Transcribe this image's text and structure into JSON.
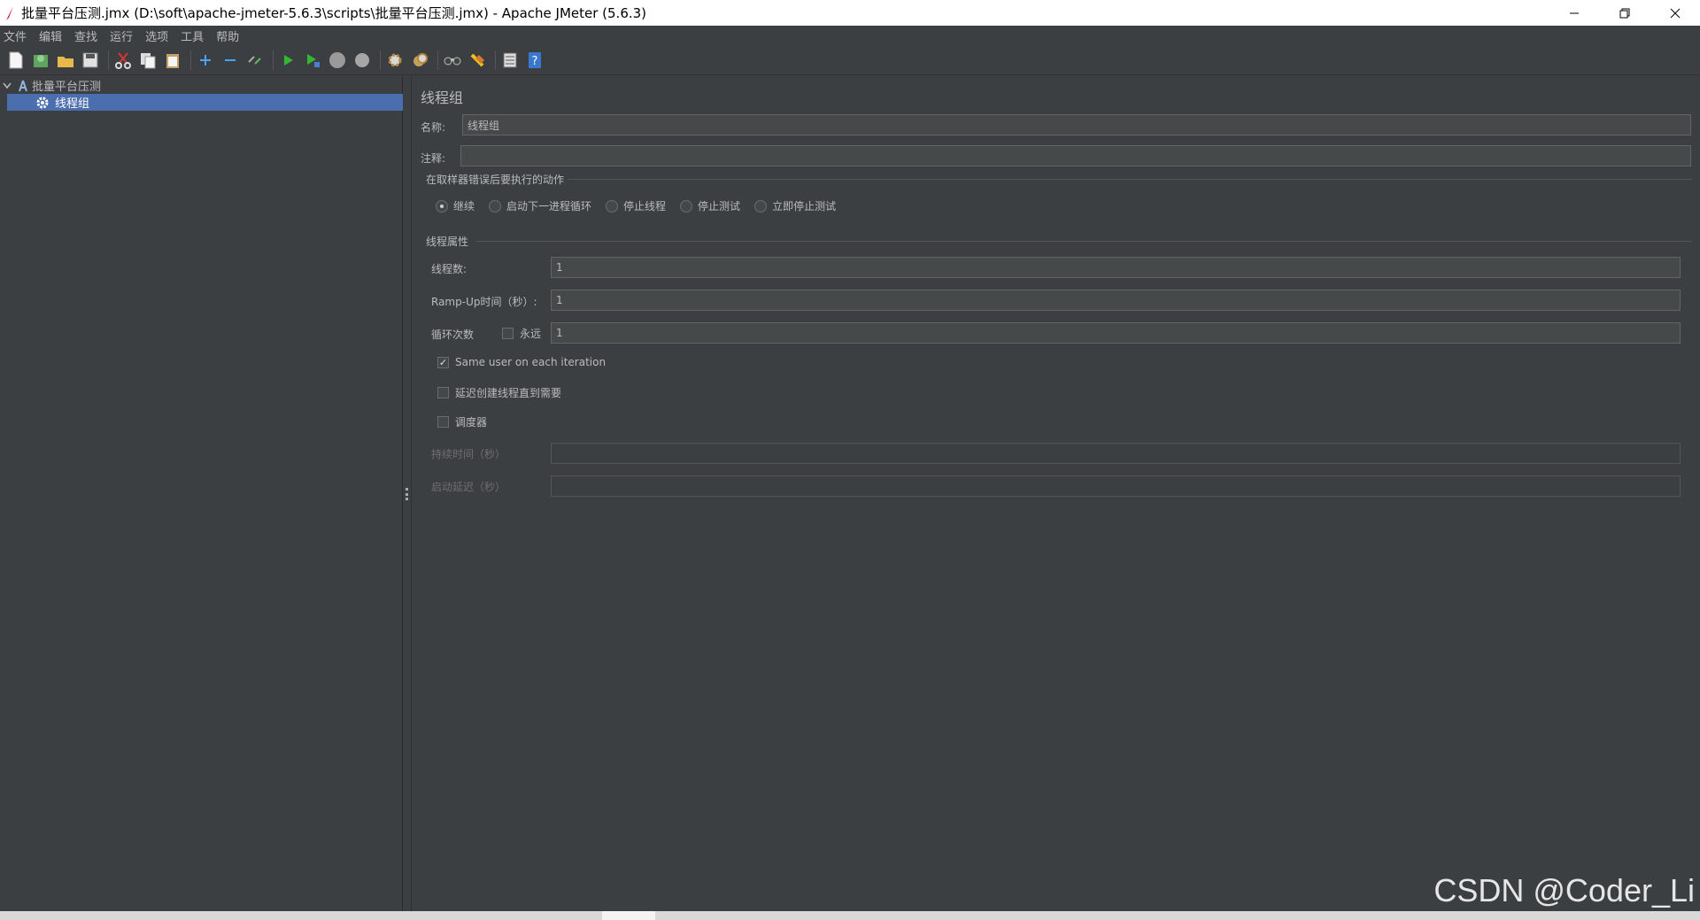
{
  "window": {
    "title": "批量平台压测.jmx (D:\\soft\\apache-jmeter-5.6.3\\scripts\\批量平台压测.jmx) - Apache JMeter (5.6.3)"
  },
  "menu": [
    "文件",
    "编辑",
    "查找",
    "运行",
    "选项",
    "工具",
    "帮助"
  ],
  "toolbar": {
    "icons": [
      "new-icon",
      "templates-icon",
      "open-icon",
      "save-icon",
      "cut-icon",
      "copy-icon",
      "paste-icon",
      "expand-icon",
      "collapse-icon",
      "toggle-icon",
      "start-icon",
      "start-no-pause-icon",
      "stop-icon",
      "shutdown-icon",
      "clear-icon",
      "clear-all-icon",
      "search-icon",
      "reset-search-icon",
      "function-helper-icon",
      "help-icon"
    ]
  },
  "tree": {
    "root": "批量平台压测",
    "child": "线程组"
  },
  "panel": {
    "title": "线程组",
    "name_label": "名称:",
    "name_value": "线程组",
    "comment_label": "注释:",
    "comment_value": "",
    "error_section": "在取样器错误后要执行的动作",
    "error_options": [
      "继续",
      "启动下一进程循环",
      "停止线程",
      "停止测试",
      "立即停止测试"
    ],
    "thread_section": "线程属性",
    "threads_label": "线程数:",
    "threads_value": "1",
    "rampup_label": "Ramp-Up时间（秒）:",
    "rampup_value": "1",
    "loop_label": "循环次数",
    "forever_label": "永远",
    "loop_value": "1",
    "same_user_label": "Same user on each iteration",
    "delay_label": "延迟创建线程直到需要",
    "scheduler_label": "调度器",
    "duration_label": "持续时间（秒）",
    "duration_value": "",
    "startup_delay_label": "启动延迟（秒）",
    "startup_delay_value": ""
  },
  "watermark": "CSDN @Coder_Li"
}
